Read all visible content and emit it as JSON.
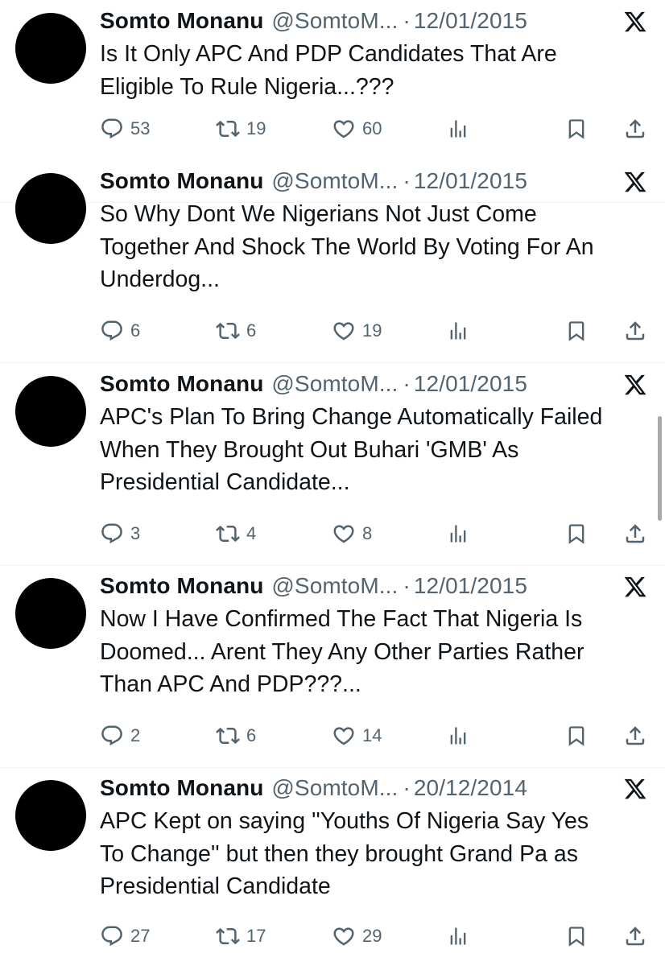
{
  "tweets": [
    {
      "name": "Somto Monanu",
      "handle": "@SomtoM...",
      "separator": "·",
      "date": "12/01/2015",
      "lines": [
        "Is It Only APC And PDP Candidates That Are",
        "Eligible To Rule Nigeria...???"
      ],
      "replies": "53",
      "retweets": "19",
      "likes": "60"
    },
    {
      "name": "Somto Monanu",
      "handle": "@SomtoM...",
      "separator": "·",
      "date": "12/01/2015",
      "lines": [
        "So Why Dont We Nigerians Not Just Come",
        "Together And Shock The World By Voting For An",
        "Underdog..."
      ],
      "replies": "6",
      "retweets": "6",
      "likes": "19"
    },
    {
      "name": "Somto Monanu",
      "handle": "@SomtoM...",
      "separator": "·",
      "date": "12/01/2015",
      "lines": [
        "APC's Plan To Bring Change Automatically Failed",
        "When They Brought Out Buhari 'GMB' As",
        "Presidential Candidate..."
      ],
      "replies": "3",
      "retweets": "4",
      "likes": "8"
    },
    {
      "name": "Somto Monanu",
      "handle": "@SomtoM...",
      "separator": "·",
      "date": "12/01/2015",
      "lines": [
        "Now I Have Confirmed The Fact That Nigeria Is",
        "Doomed... Arent They Any Other Parties Rather",
        "Than APC And PDP???..."
      ],
      "replies": "2",
      "retweets": "6",
      "likes": "14"
    },
    {
      "name": "Somto Monanu",
      "handle": "@SomtoM...",
      "separator": "·",
      "date": "20/12/2014",
      "lines": [
        "APC Kept on saying ''Youths Of Nigeria Say Yes",
        "To Change'' but then they brought Grand Pa as",
        "Presidential Candidate"
      ],
      "replies": "27",
      "retweets": "17",
      "likes": "29"
    }
  ],
  "icons": {
    "platform": "x-logo-icon",
    "reply": "reply-icon",
    "retweet": "retweet-icon",
    "like": "heart-icon",
    "views": "views-icon",
    "bookmark": "bookmark-icon",
    "share": "share-icon"
  },
  "colors": {
    "text": "#0f1419",
    "secondary": "#536471",
    "avatar": "#000000",
    "divider": "#eff3f4",
    "scrollbar": "#a9a9a9"
  }
}
